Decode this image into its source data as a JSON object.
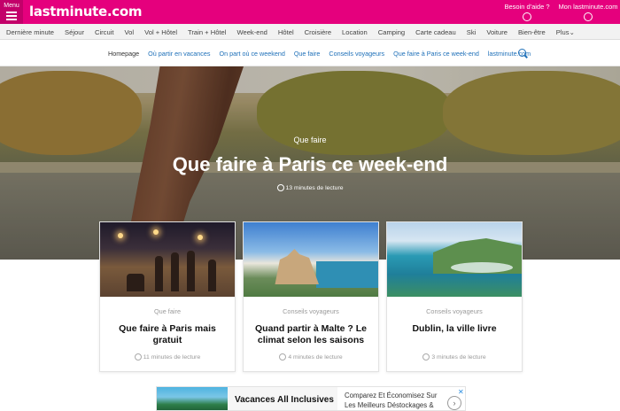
{
  "header": {
    "menu_label": "Menu",
    "logo": "lastminute.com",
    "help_label": "Besoin d'aide ?",
    "account_label": "Mon lastminute.com"
  },
  "categories": [
    "Dernière minute",
    "Séjour",
    "Circuit",
    "Vol",
    "Vol + Hôtel",
    "Train + Hôtel",
    "Week-end",
    "Hôtel",
    "Croisière",
    "Location",
    "Camping",
    "Carte cadeau",
    "Ski",
    "Voiture",
    "Bien-être",
    "Plus"
  ],
  "subnav": [
    "Homepage",
    "Où partir en vacances",
    "On part où ce weekend",
    "Que faire",
    "Conseils voyageurs",
    "Que faire à Paris ce week-end",
    "lastminute.com"
  ],
  "hero": {
    "category": "Que faire",
    "title": "Que faire à Paris ce week-end",
    "read_time": "13 minutes de lecture"
  },
  "cards": [
    {
      "category": "Que faire",
      "title": "Que faire à Paris mais gratuit",
      "read_time": "11 minutes de lecture"
    },
    {
      "category": "Conseils voyageurs",
      "title": "Quand partir à Malte ? Le climat selon les saisons",
      "read_time": "4 minutes de lecture"
    },
    {
      "category": "Conseils voyageurs",
      "title": "Dublin, la ville livre",
      "read_time": "3 minutes de lecture"
    }
  ],
  "ad": {
    "title": "Vacances All Inclusives",
    "text": "Comparez Et Économisez Sur Les Meilleurs Déstockages &",
    "close": "✕"
  },
  "colors": {
    "brand": "#e5007d",
    "link": "#1d6fb8"
  }
}
